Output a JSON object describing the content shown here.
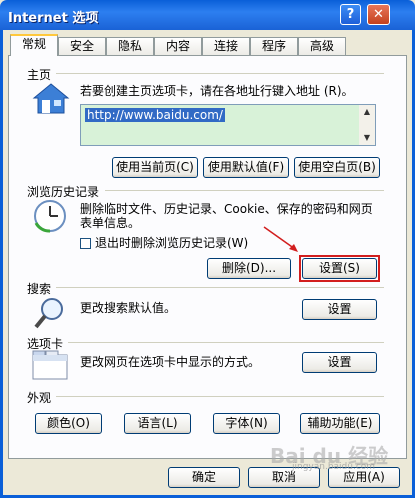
{
  "window": {
    "title": "Internet 选项",
    "help_label": "?",
    "close_label": "✕"
  },
  "tabs": [
    "常规",
    "安全",
    "隐私",
    "内容",
    "连接",
    "程序",
    "高级"
  ],
  "home": {
    "section_label": "主页",
    "description": "若要创建主页选项卡，请在各地址行键入地址 (R)。",
    "url": "http://www.baidu.com/",
    "buttons": [
      "使用当前页(C)",
      "使用默认值(F)",
      "使用空白页(B)"
    ]
  },
  "history": {
    "section_label": "浏览历史记录",
    "description_line1": "删除临时文件、历史记录、Cookie、保存的密码和网页",
    "description_line2": "表单信息。",
    "checkbox_label": "退出时删除浏览历史记录(W)",
    "checkbox_checked": false,
    "delete_label": "删除(D)...",
    "settings_label": "设置(S)"
  },
  "search": {
    "section_label": "搜索",
    "description": "更改搜索默认值。",
    "settings_label": "设置"
  },
  "tabs_section": {
    "section_label": "选项卡",
    "description": "更改网页在选项卡中显示的方式。",
    "settings_label": "设置"
  },
  "appearance": {
    "section_label": "外观",
    "buttons": [
      "颜色(O)",
      "语言(L)",
      "字体(N)",
      "辅助功能(E)"
    ]
  },
  "footer": {
    "ok_label": "确定",
    "cancel_label": "取消",
    "apply_label": "应用(A)"
  },
  "watermark": {
    "text": "Bai du 经验",
    "sub": "jingyan.baidu.com"
  }
}
